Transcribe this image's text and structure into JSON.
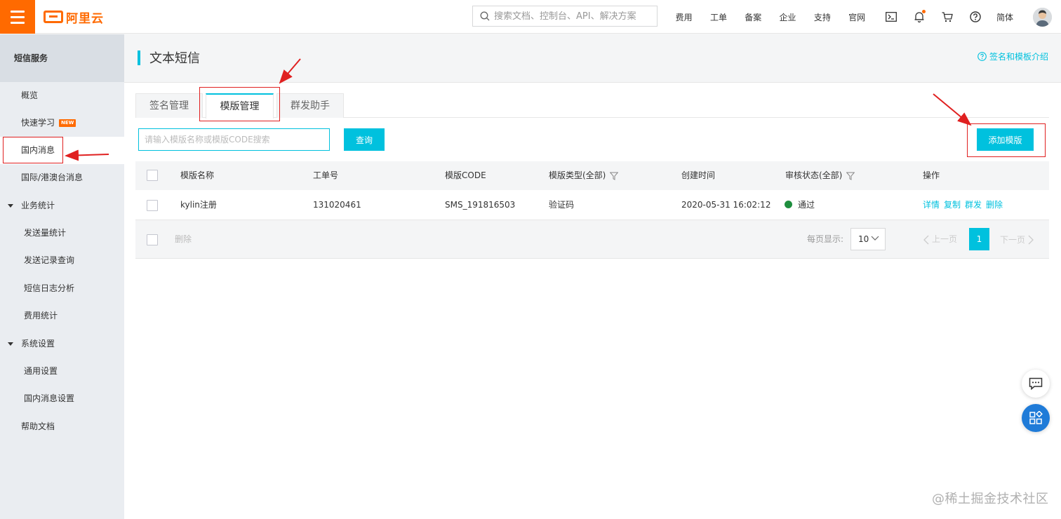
{
  "brand": {
    "logo_text": "阿里云",
    "accent": "#ff6a00",
    "primary": "#00c1de"
  },
  "search": {
    "placeholder": "搜索文档、控制台、API、解决方案"
  },
  "topnav": [
    "费用",
    "工单",
    "备案",
    "企业",
    "支持",
    "官网"
  ],
  "top_icons": [
    "terminal-icon",
    "bell-icon",
    "cart-icon",
    "help-icon"
  ],
  "lang": "简体",
  "sidebar": {
    "header": "短信服务",
    "items": [
      {
        "label": "概览"
      },
      {
        "label": "快速学习",
        "badge": "NEW"
      },
      {
        "label": "国内消息"
      },
      {
        "label": "国际/港澳台消息"
      },
      {
        "label": "业务统计"
      },
      {
        "label": "发送量统计"
      },
      {
        "label": "发送记录查询"
      },
      {
        "label": "短信日志分析"
      },
      {
        "label": "费用统计"
      },
      {
        "label": "系统设置"
      },
      {
        "label": "通用设置"
      },
      {
        "label": "国内消息设置"
      },
      {
        "label": "帮助文档"
      }
    ]
  },
  "page": {
    "title": "文本短信",
    "help_link": "签名和模板介绍"
  },
  "tabs": [
    {
      "label": "签名管理"
    },
    {
      "label": "模版管理"
    },
    {
      "label": "群发助手"
    }
  ],
  "query": {
    "placeholder": "请输入模版名称或模版CODE搜索",
    "query_button": "查询",
    "add_button": "添加模版"
  },
  "table": {
    "columns": [
      "模版名称",
      "工单号",
      "模版CODE",
      "模版类型(全部)",
      "创建时间",
      "审核状态(全部)",
      "操作"
    ],
    "rows": [
      {
        "name": "kylin注册",
        "ticket": "131020461",
        "code": "SMS_191816503",
        "type": "验证码",
        "created": "2020-05-31 16:02:12",
        "status": "通过",
        "actions": [
          "详情",
          "复制",
          "群发",
          "删除"
        ]
      }
    ],
    "footer": {
      "delete": "删除",
      "per_page_label": "每页显示:",
      "per_page_value": "10",
      "prev": "上一页",
      "current_page": "1",
      "next": "下一页"
    }
  },
  "watermark": "@稀土掘金技术社区"
}
